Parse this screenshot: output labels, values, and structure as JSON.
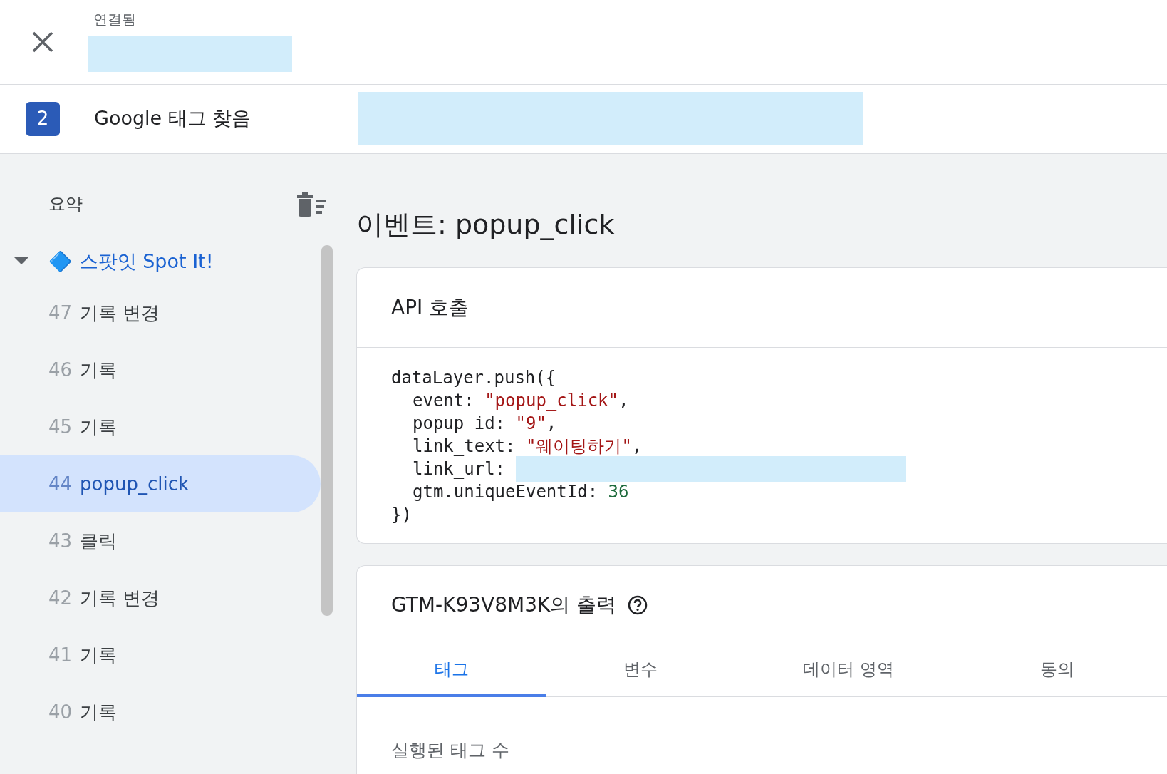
{
  "header": {
    "status": "연결됨",
    "step": {
      "number": "2",
      "label": "Google 태그 찾음"
    }
  },
  "sidebar": {
    "title": "요약",
    "group": {
      "label": "🔷 스팟잇 Spot It!",
      "expanded": true,
      "items": [
        {
          "number": "47",
          "label": "기록 변경",
          "selected": false
        },
        {
          "number": "46",
          "label": "기록",
          "selected": false
        },
        {
          "number": "45",
          "label": "기록",
          "selected": false
        },
        {
          "number": "44",
          "label": "popup_click",
          "selected": true
        },
        {
          "number": "43",
          "label": "클릭",
          "selected": false
        },
        {
          "number": "42",
          "label": "기록 변경",
          "selected": false
        },
        {
          "number": "41",
          "label": "기록",
          "selected": false
        },
        {
          "number": "40",
          "label": "기록",
          "selected": false
        }
      ]
    }
  },
  "main": {
    "title": "이벤트: popup_click",
    "api_card": {
      "title": "API 호출",
      "open": "dataLayer.push({",
      "close": "})",
      "lines": [
        {
          "key": "event:",
          "kind": "string",
          "value": "\"popup_click\"",
          "trail": ","
        },
        {
          "key": "popup_id:",
          "kind": "string",
          "value": "\"9\"",
          "trail": ","
        },
        {
          "key": "link_text:",
          "kind": "string",
          "value": "\"웨이팅하기\"",
          "trail": ","
        },
        {
          "key": "link_url:",
          "kind": "redacted"
        },
        {
          "key": "gtm.uniqueEventId:",
          "kind": "number",
          "value": "36"
        }
      ]
    },
    "output_card": {
      "title": "GTM-K93V8M3K의 출력",
      "tabs": [
        {
          "label": "태그",
          "selected": true
        },
        {
          "label": "변수",
          "selected": false
        },
        {
          "label": "데이터 영역",
          "selected": false
        },
        {
          "label": "동의",
          "selected": false
        }
      ],
      "section_label": "실행된 태그 수"
    }
  }
}
